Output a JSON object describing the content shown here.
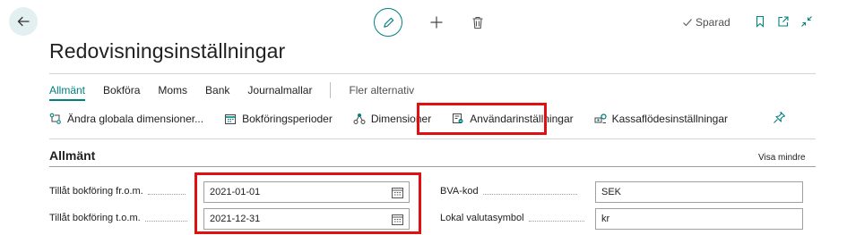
{
  "header": {
    "saved_label": "Sparad"
  },
  "page": {
    "title": "Redovisningsinställningar"
  },
  "tabs": [
    {
      "label": "Allmänt",
      "active": true
    },
    {
      "label": "Bokföra"
    },
    {
      "label": "Moms"
    },
    {
      "label": "Bank"
    },
    {
      "label": "Journalmallar"
    }
  ],
  "tabs_more": "Fler alternativ",
  "actions": [
    {
      "label": "Ändra globala dimensioner...",
      "icon": "change-dimensions-icon"
    },
    {
      "label": "Bokföringsperioder",
      "icon": "calendar-periods-icon"
    },
    {
      "label": "Dimensioner",
      "icon": "dimensions-icon"
    },
    {
      "label": "Användarinställningar",
      "icon": "user-setup-icon"
    },
    {
      "label": "Kassaflödesinställningar",
      "icon": "cashflow-icon"
    }
  ],
  "section": {
    "title": "Allmänt",
    "show_less": "Visa mindre"
  },
  "fields": {
    "allow_from": {
      "label": "Tillåt bokföring fr.o.m.",
      "value": "2021-01-01"
    },
    "allow_to": {
      "label": "Tillåt bokföring t.o.m.",
      "value": "2021-12-31"
    },
    "lcy_code": {
      "label": "BVA-kod",
      "value": "SEK"
    },
    "local_currency_symbol": {
      "label": "Lokal valutasymbol",
      "value": "kr"
    }
  },
  "colors": {
    "accent": "#00807f",
    "highlight": "#e01010"
  }
}
